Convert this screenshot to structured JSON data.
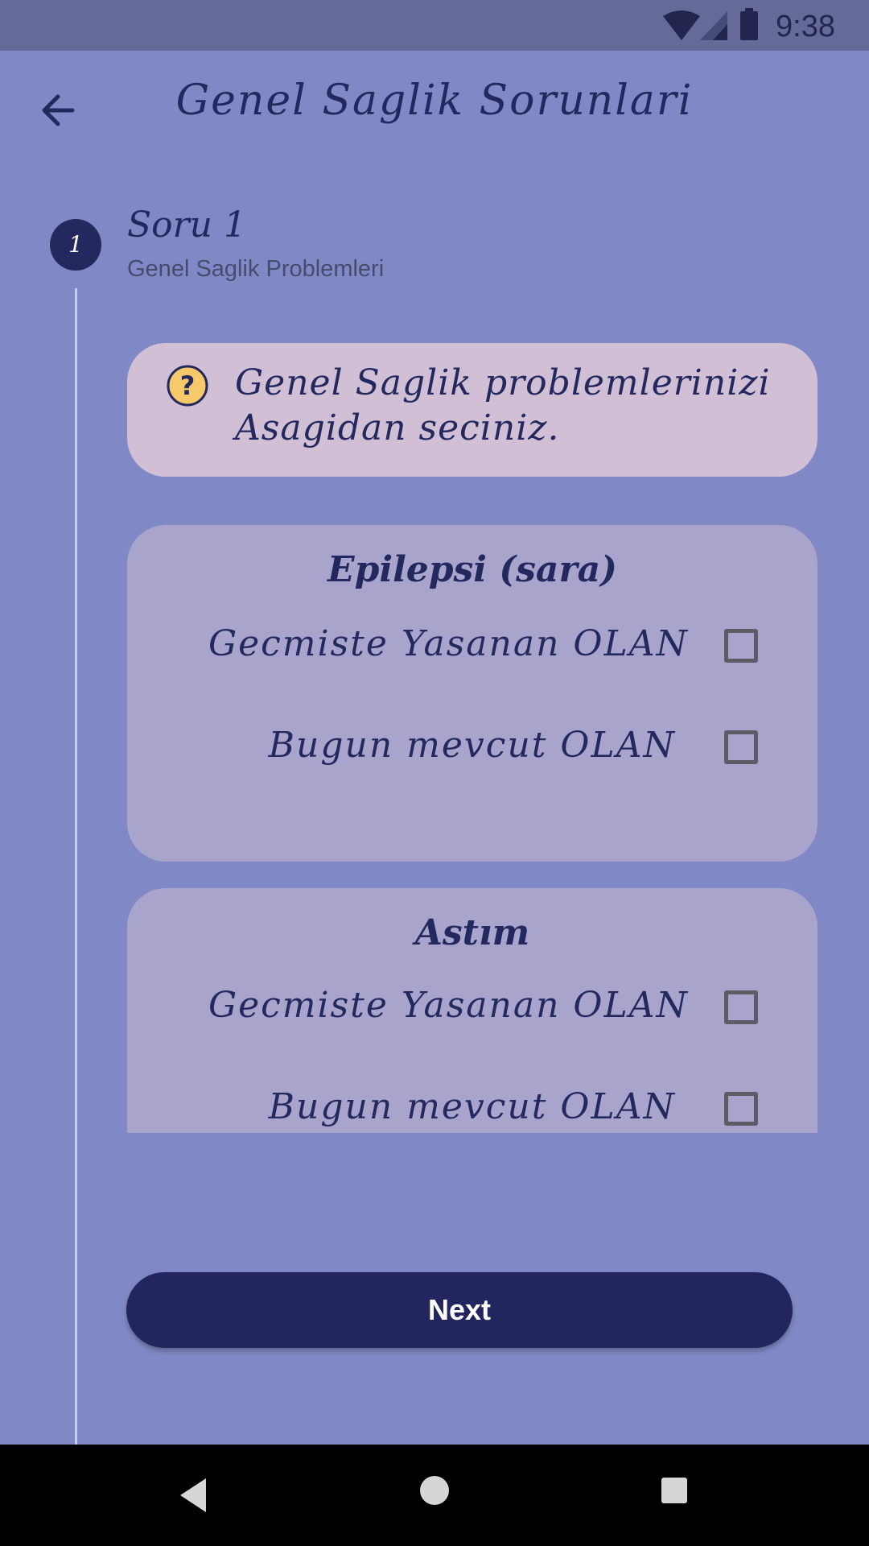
{
  "status_bar": {
    "time": "9:38"
  },
  "app_bar": {
    "title": "Genel Saglik Sorunlari",
    "back_icon": "arrow-left-icon"
  },
  "stepper": {
    "step_number": "1",
    "title": "Soru 1",
    "subtitle": "Genel Saglik Problemleri"
  },
  "question": {
    "icon": "question-mark-icon",
    "text": "Genel Saglik problemlerinizi Asagidan seciniz."
  },
  "conditions": [
    {
      "title": "Epilepsi (sara)",
      "options": [
        {
          "label": "Gecmiste Yasanan OLAN",
          "checked": false
        },
        {
          "label": "Bugun mevcut OLAN",
          "checked": false
        }
      ]
    },
    {
      "title": "Astım",
      "options": [
        {
          "label": "Gecmiste Yasanan OLAN",
          "checked": false
        },
        {
          "label": "Bugun mevcut OLAN",
          "checked": false
        }
      ]
    }
  ],
  "next_button": {
    "label": "Next"
  },
  "colors": {
    "background": "#8089c5",
    "primary": "#23285e",
    "question_card": "#d0bfd5",
    "condition_card": "#a8a4cc"
  }
}
